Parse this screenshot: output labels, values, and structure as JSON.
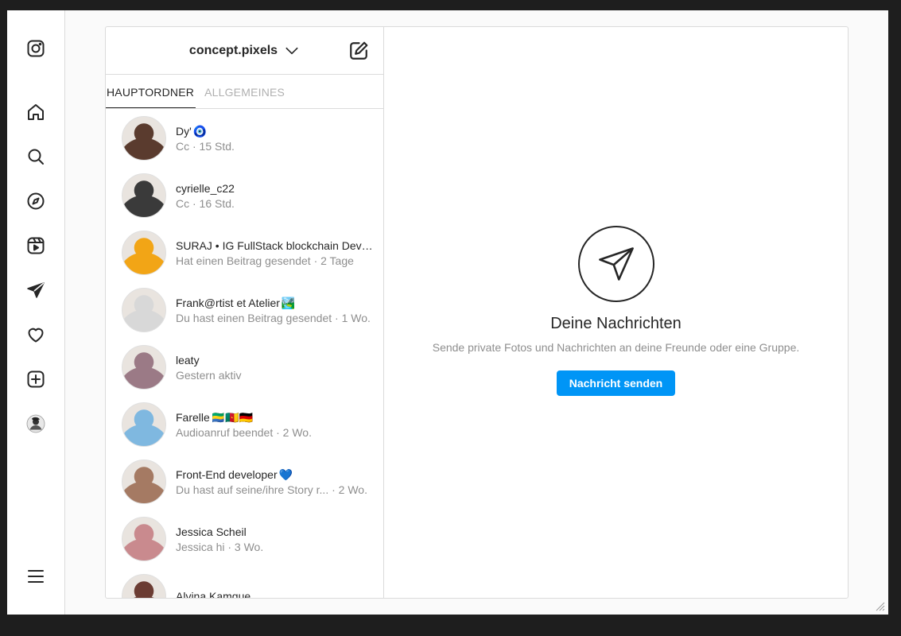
{
  "rail": {
    "icons": [
      "instagram-logo-icon",
      "home-icon",
      "search-icon",
      "explore-icon",
      "reels-icon",
      "messages-icon",
      "notifications-heart-icon",
      "create-icon",
      "profile-avatar",
      "menu-icon"
    ]
  },
  "header": {
    "account_name": "concept.pixels"
  },
  "tabs": [
    {
      "label": "HAUPTORDNER",
      "active": true
    },
    {
      "label": "ALLGEMEINES",
      "active": false
    }
  ],
  "threads": [
    {
      "name": "Dy'",
      "emoji": "🧿",
      "sub": "Cc · 15 Std.",
      "avatar_color": "#5a3b2e"
    },
    {
      "name": "cyrielle_c22",
      "sub": "Cc · 16 Std.",
      "avatar_color": "#3a3a3a"
    },
    {
      "name": "SURAJ • IG FullStack blockchain Developer",
      "sub": "Hat einen Beitrag gesendet · 2 Tage",
      "avatar_color": "#f2a516"
    },
    {
      "name": "Frank@rtist et Atelier",
      "emoji": "🏞️",
      "sub": "Du hast einen Beitrag gesendet · 1 Wo.",
      "avatar_color": "#d8d8d8"
    },
    {
      "name": "leaty",
      "sub": "Gestern aktiv",
      "avatar_color": "#9b7a86"
    },
    {
      "name": "Farelle",
      "flags": "🇬🇦🇨🇲🇩🇪",
      "sub": "Audioanruf beendet · 2 Wo.",
      "avatar_color": "#7fb8e0"
    },
    {
      "name": "Front-End developer",
      "emoji": "💙",
      "sub": "Du hast auf seine/ihre Story r...  · 2 Wo.",
      "avatar_color": "#a57a63"
    },
    {
      "name": "Jessica Scheil",
      "sub": "Jessica hi · 3 Wo.",
      "avatar_color": "#c98a8e"
    },
    {
      "name": "Alvina Kamgue",
      "sub": "",
      "avatar_color": "#6b3c33"
    }
  ],
  "empty_state": {
    "title": "Deine Nachrichten",
    "subtitle": "Sende private Fotos und Nachrichten an deine Freunde oder eine Gruppe.",
    "button": "Nachricht senden"
  },
  "colors": {
    "accent": "#0095f6",
    "border": "#dbdbdb",
    "text_primary": "#262626",
    "text_secondary": "#8e8e8e"
  }
}
